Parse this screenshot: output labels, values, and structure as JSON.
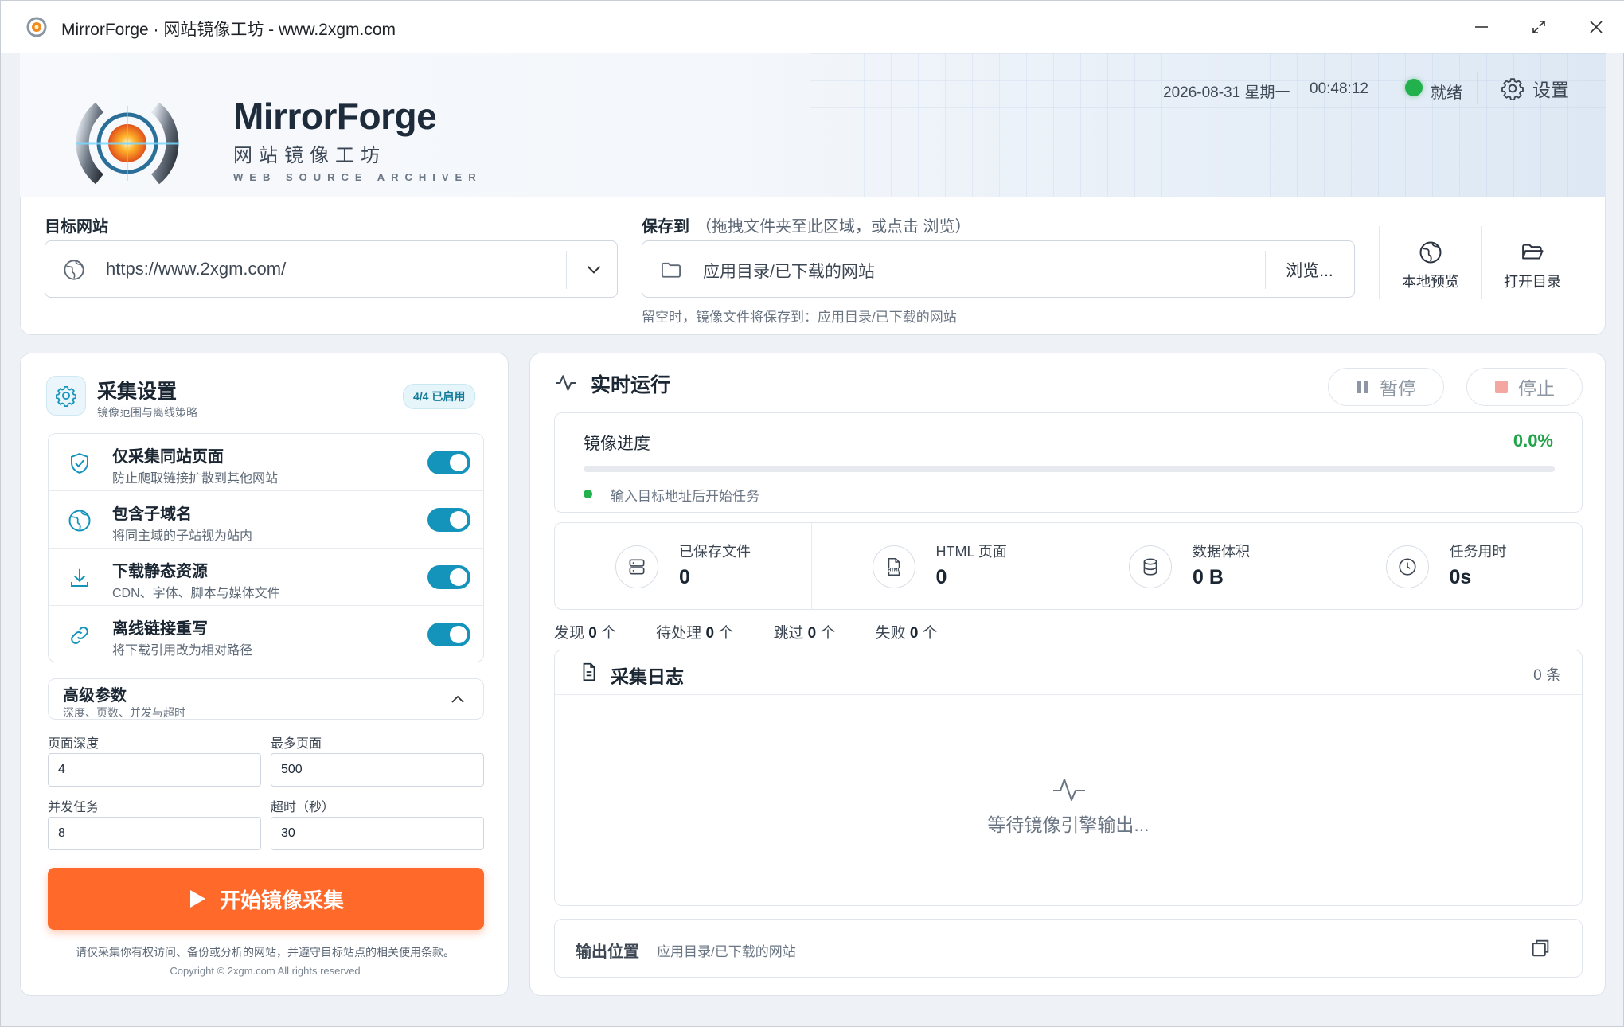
{
  "window": {
    "title": "MirrorForge · 网站镜像工坊 - www.2xgm.com",
    "controls": [
      "minimize",
      "maximize",
      "close"
    ]
  },
  "header": {
    "brand_name": "MirrorForge",
    "brand_cn": "网站镜像工坊",
    "brand_en": "WEB SOURCE ARCHIVER",
    "date": "2026-08-31 星期一",
    "time": "00:48:12",
    "status": "就绪",
    "status_color": "#22b14c",
    "settings_label": "设置"
  },
  "target": {
    "url_label": "目标网站",
    "url_value": "https://www.2xgm.com/",
    "save_label": "保存到",
    "save_hint_inline": "（拖拽文件夹至此区域，或点击 浏览）",
    "save_value": "应用目录/已下载的网站",
    "browse_label": "浏览...",
    "save_hint": "留空时，镜像文件将保存到：应用目录/已下载的网站",
    "preview_label": "本地预览",
    "open_dir_label": "打开目录"
  },
  "settings": {
    "title": "采集设置",
    "subtitle": "镜像范围与离线策略",
    "badge": "4/4 已启用",
    "options": [
      {
        "title": "仅采集同站页面",
        "desc": "防止爬取链接扩散到其他网站",
        "icon": "shield-check-icon",
        "enabled": true
      },
      {
        "title": "包含子域名",
        "desc": "将同主域的子站视为站内",
        "icon": "globe-icon",
        "enabled": true
      },
      {
        "title": "下载静态资源",
        "desc": "CDN、字体、脚本与媒体文件",
        "icon": "download-icon",
        "enabled": true
      },
      {
        "title": "离线链接重写",
        "desc": "将下载引用改为相对路径",
        "icon": "link-icon",
        "enabled": true
      }
    ],
    "advanced": {
      "title": "高级参数",
      "subtitle": "深度、页数、并发与超时",
      "depth_label": "页面深度",
      "depth_value": "4",
      "max_pages_label": "最多页面",
      "max_pages_value": "500",
      "concurrency_label": "并发任务",
      "concurrency_value": "8",
      "timeout_label": "超时（秒）",
      "timeout_value": "30"
    },
    "start_label": "开始镜像采集",
    "start_color": "#ff6a2b",
    "disclaimer": "请仅采集你有权访问、备份或分析的网站，并遵守目标站点的相关使用条款。",
    "copyright": "Copyright © 2xgm.com All rights reserved"
  },
  "runtime": {
    "title": "实时运行",
    "pause_label": "暂停",
    "stop_label": "停止",
    "progress_label": "镜像进度",
    "progress_value": "0.0%",
    "progress_fraction": 0.0,
    "progress_message": "输入目标地址后开始任务",
    "stats": [
      {
        "label": "已保存文件",
        "value": "0",
        "icon": "server-icon"
      },
      {
        "label": "HTML 页面",
        "value": "0",
        "icon": "html-file-icon"
      },
      {
        "label": "数据体积",
        "value": "0 B",
        "icon": "database-icon"
      },
      {
        "label": "任务用时",
        "value": "0s",
        "icon": "clock-icon"
      }
    ],
    "counts": {
      "found_label": "发现",
      "found": "0",
      "found_unit": "个",
      "pending_label": "待处理",
      "pending": "0",
      "pending_unit": "个",
      "skipped_label": "跳过",
      "skipped": "0",
      "skipped_unit": "个",
      "failed_label": "失败",
      "failed": "0",
      "failed_unit": "个"
    },
    "log_title": "采集日志",
    "log_count": "0 条",
    "log_empty": "等待镜像引擎输出...",
    "output_label": "输出位置",
    "output_value": "应用目录/已下载的网站"
  }
}
